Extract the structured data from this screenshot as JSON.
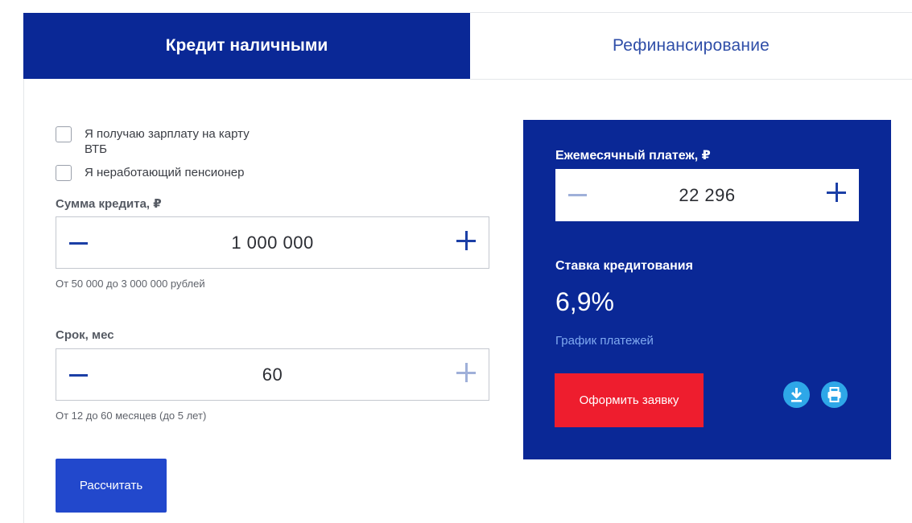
{
  "tabs": [
    {
      "label": "Кредит наличными",
      "active": true
    },
    {
      "label": "Рефинансирование",
      "active": false
    }
  ],
  "checkboxes": [
    {
      "label_line1": "Я получаю зарплату на карту",
      "label_line2": "ВТБ",
      "checked": false
    },
    {
      "label": "Я неработающий пенсионер",
      "checked": false
    }
  ],
  "loan_amount": {
    "label": "Сумма кредита, ₽",
    "value": "1 000 000",
    "hint": "От 50 000 до 3 000 000 рублей"
  },
  "loan_term": {
    "label": "Срок, мес",
    "value": "60",
    "hint": "От 12 до 60 месяцев (до 5 лет)"
  },
  "calculate_button": "Рассчитать",
  "result_panel": {
    "payment_label": "Ежемесячный платеж, ₽",
    "payment_value": "22 296",
    "rate_label": "Ставка кредитования",
    "rate_value": "6,9%",
    "schedule_link": "График платежей",
    "apply_button": "Оформить заявку"
  },
  "icons": [
    "minus-icon",
    "plus-icon",
    "download-icon",
    "print-icon"
  ],
  "colors": {
    "brand_blue": "#0a2896",
    "button_blue": "#2248cc",
    "apply_red": "#ee1d2e",
    "icon_cyan": "#2ea7e8",
    "link_light_blue": "#7fa9f0"
  }
}
